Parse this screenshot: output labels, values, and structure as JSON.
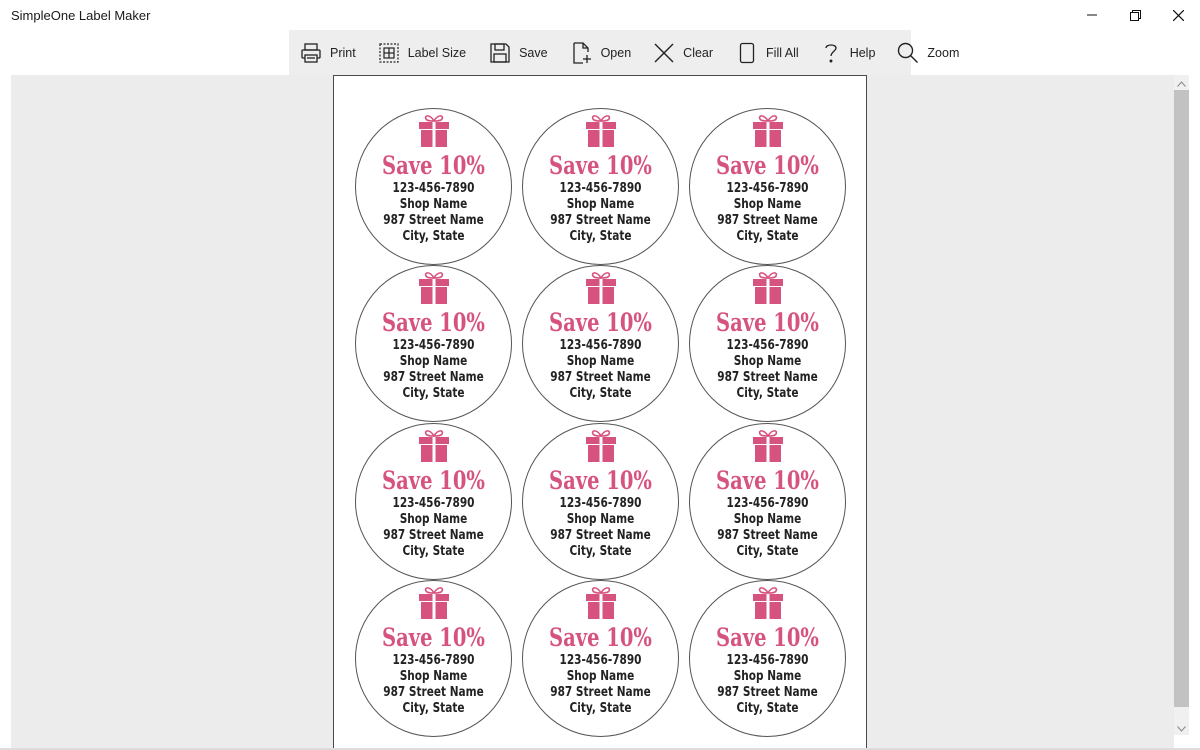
{
  "window": {
    "title": "SimpleOne Label Maker",
    "controls": {
      "minimize": "minimize-icon",
      "restore": "restore-icon",
      "close": "close-icon"
    }
  },
  "toolbar": {
    "items": [
      {
        "id": "print",
        "label": "Print",
        "icon": "printer-icon"
      },
      {
        "id": "label-size",
        "label": "Label Size",
        "icon": "grid-icon"
      },
      {
        "id": "save",
        "label": "Save",
        "icon": "floppy-disk-icon"
      },
      {
        "id": "open",
        "label": "Open",
        "icon": "open-file-icon"
      },
      {
        "id": "clear",
        "label": "Clear",
        "icon": "x-icon"
      },
      {
        "id": "fill-all",
        "label": "Fill All",
        "icon": "page-icon"
      },
      {
        "id": "help",
        "label": "Help",
        "icon": "question-mark-icon"
      },
      {
        "id": "zoom",
        "label": "Zoom",
        "icon": "magnifier-icon"
      }
    ]
  },
  "sheet": {
    "rows": 4,
    "columns": 3,
    "label": {
      "icon": "gift-box-icon",
      "headline": "Save 10%",
      "phone": "123-456-7890",
      "shop": "Shop Name",
      "street": "987 Street Name",
      "city": "City, State"
    }
  },
  "colors": {
    "accent_pink": "#d6537f",
    "toolbar_bg": "#eeeeee",
    "workspace_bg": "#ececec",
    "text_dark": "#222222"
  },
  "scrollbar": {
    "up_icon": "chevron-up-icon",
    "down_icon": "chevron-down-icon"
  }
}
